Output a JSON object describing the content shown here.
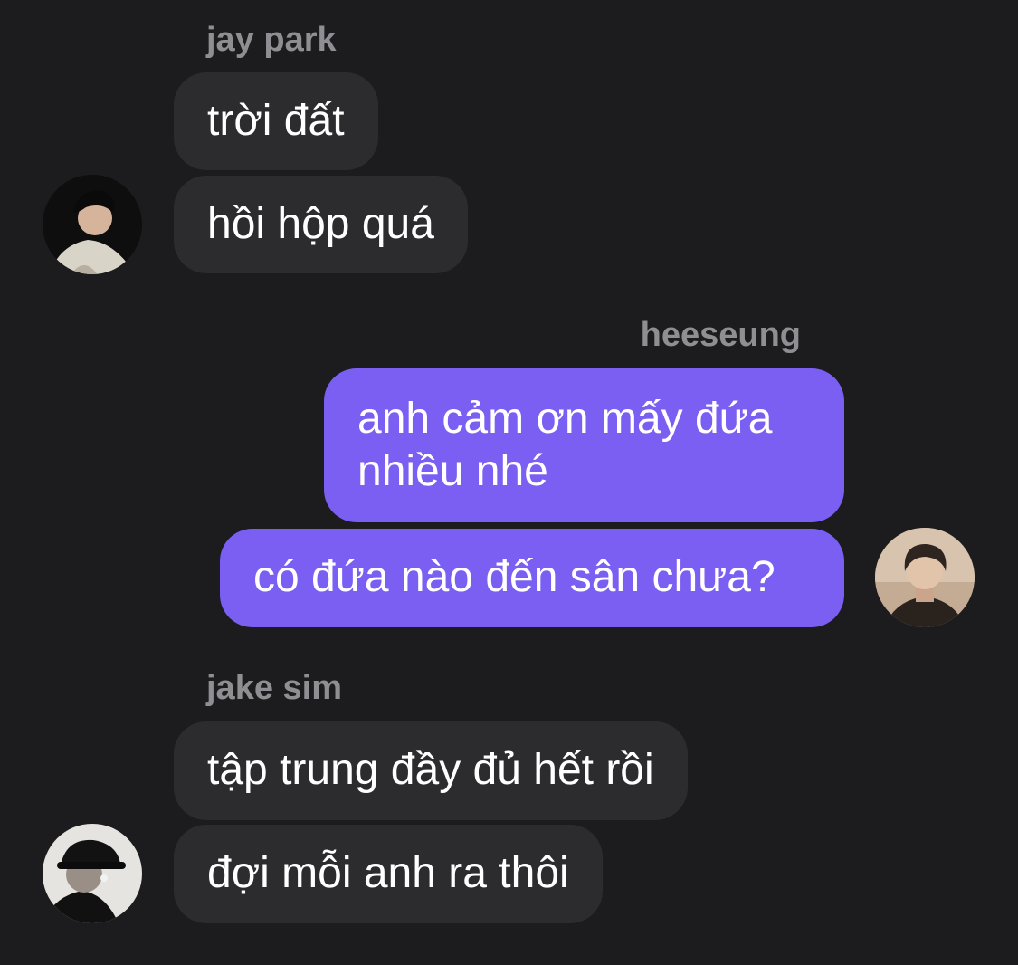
{
  "groups": [
    {
      "sender": "jay park",
      "avatar_icon": "user-avatar-icon",
      "messages": [
        "trời đất",
        "hồi hộp quá"
      ]
    },
    {
      "sender": "heeseung",
      "avatar_icon": "user-avatar-icon",
      "messages": [
        [
          "anh cảm ơn mấy đứa",
          "nhiều nhé"
        ],
        "có đứa nào đến sân chưa?"
      ]
    },
    {
      "sender": "jake sim",
      "avatar_icon": "user-avatar-icon",
      "messages": [
        "tập trung đầy đủ hết rồi",
        "đợi mỗi anh ra thôi"
      ]
    }
  ],
  "colors": {
    "background": "#1c1c1e",
    "incoming_bubble": "#2c2c2e",
    "outgoing_bubble": "#7b5ff2",
    "sender_name": "#8e8e93",
    "message_text": "#ffffff"
  }
}
